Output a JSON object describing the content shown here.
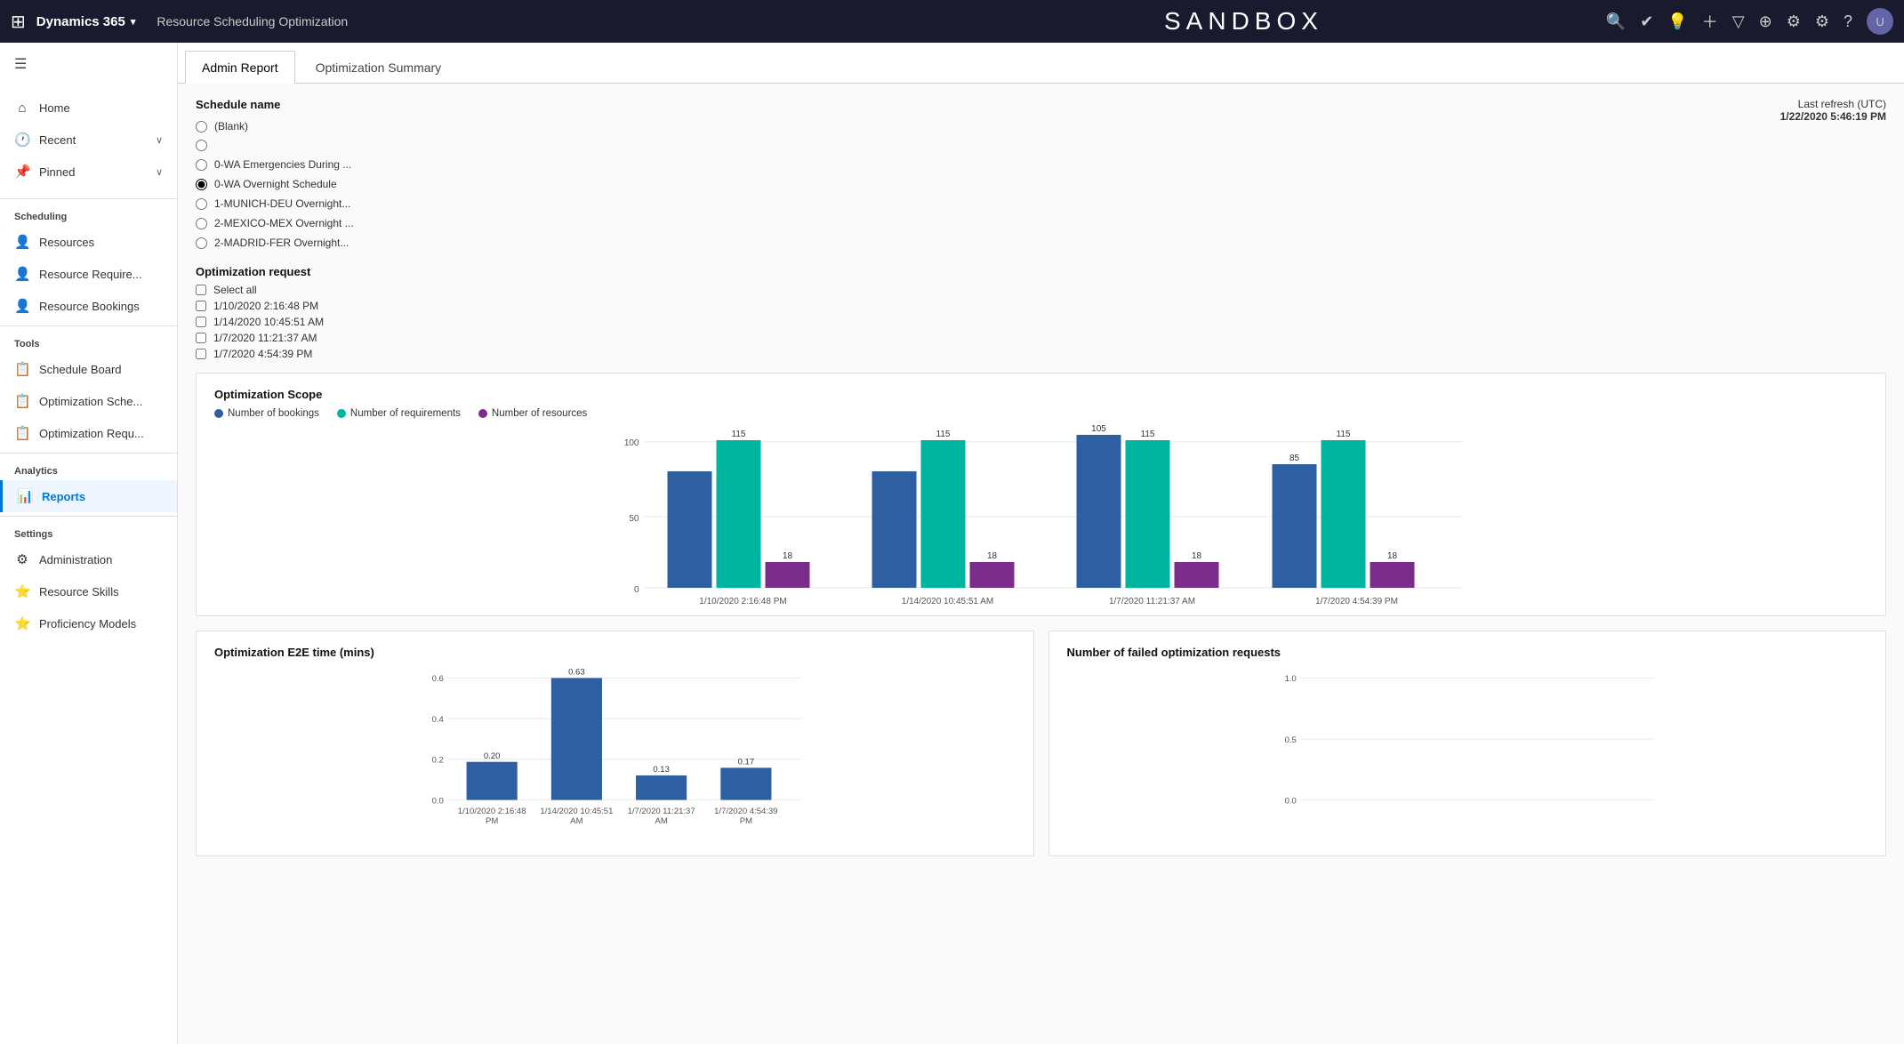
{
  "topbar": {
    "apps_icon": "⊞",
    "brand": "Dynamics 365",
    "brand_chevron": "▾",
    "title": "Resource Scheduling Optimization",
    "sandbox": "SANDBOX",
    "icons": [
      "🔍",
      "✓",
      "💡",
      "+",
      "▽",
      "⊕",
      "⚙",
      "⚙",
      "?"
    ],
    "avatar_label": "U"
  },
  "sidebar": {
    "hamburger": "☰",
    "items": [
      {
        "id": "home",
        "icon": "⌂",
        "label": "Home",
        "group": null
      },
      {
        "id": "recent",
        "icon": "🕐",
        "label": "Recent",
        "chevron": "∨",
        "group": null
      },
      {
        "id": "pinned",
        "icon": "📌",
        "label": "Pinned",
        "chevron": "∨",
        "group": null
      },
      {
        "id": "resources",
        "icon": "👤",
        "label": "Resources",
        "group": "Scheduling"
      },
      {
        "id": "resource-requirements",
        "icon": "👤",
        "label": "Resource Require...",
        "group": null
      },
      {
        "id": "resource-bookings",
        "icon": "👤",
        "label": "Resource Bookings",
        "group": null
      },
      {
        "id": "schedule-board",
        "icon": "📋",
        "label": "Schedule Board",
        "group": "Tools"
      },
      {
        "id": "optimization-schedule",
        "icon": "📋",
        "label": "Optimization Sche...",
        "group": null
      },
      {
        "id": "optimization-requests",
        "icon": "📋",
        "label": "Optimization Requ...",
        "group": null
      },
      {
        "id": "reports",
        "icon": "📊",
        "label": "Reports",
        "group": "Analytics",
        "active": true
      },
      {
        "id": "administration",
        "icon": "⚙",
        "label": "Administration",
        "group": "Settings"
      },
      {
        "id": "resource-skills",
        "icon": "⭐",
        "label": "Resource Skills",
        "group": null
      },
      {
        "id": "proficiency-models",
        "icon": "⭐",
        "label": "Proficiency Models",
        "group": null
      }
    ]
  },
  "tabs": [
    {
      "id": "admin-report",
      "label": "Admin Report",
      "active": true
    },
    {
      "id": "optimization-summary",
      "label": "Optimization Summary",
      "active": false
    }
  ],
  "filter": {
    "schedule_name_label": "Schedule name",
    "options": [
      {
        "id": "blank",
        "label": "(Blank)",
        "selected": false
      },
      {
        "id": "opt2",
        "label": "",
        "selected": false
      },
      {
        "id": "wa-emergencies",
        "label": "0-WA Emergencies During ...",
        "selected": false
      },
      {
        "id": "wa-overnight",
        "label": "0-WA Overnight Schedule",
        "selected": true
      },
      {
        "id": "munich",
        "label": "1-MUNICH-DEU Overnight...",
        "selected": false
      },
      {
        "id": "mexico",
        "label": "2-MEXICO-MEX Overnight ...",
        "selected": false
      },
      {
        "id": "madrid",
        "label": "2-MADRID-FER Overnight...",
        "selected": false
      }
    ],
    "optimization_request_label": "Optimization request",
    "checkboxes": [
      {
        "id": "select-all",
        "label": "Select all",
        "checked": false
      },
      {
        "id": "req1",
        "label": "1/10/2020 2:16:48 PM",
        "checked": false
      },
      {
        "id": "req2",
        "label": "1/14/2020 10:45:51 AM",
        "checked": false
      },
      {
        "id": "req3",
        "label": "1/7/2020 11:21:37 AM",
        "checked": false
      },
      {
        "id": "req4",
        "label": "1/7/2020 4:54:39 PM",
        "checked": false
      }
    ]
  },
  "last_refresh": {
    "label": "Last refresh (UTC)",
    "value": "1/22/2020 5:46:19 PM"
  },
  "scope_chart": {
    "title": "Optimization Scope",
    "legend": [
      {
        "label": "Number of bookings",
        "color": "#2e5fa3"
      },
      {
        "label": "Number of requirements",
        "color": "#00b5a0"
      },
      {
        "label": "Number of resources",
        "color": "#7b2d8b"
      }
    ],
    "y_labels": [
      "100",
      "50",
      "0"
    ],
    "groups": [
      {
        "label": "1/10/2020 2:16:48 PM",
        "bookings": 80,
        "bookings_val": "~80",
        "requirements": 115,
        "requirements_val": "115",
        "resources": 18,
        "resources_val": "18"
      },
      {
        "label": "1/14/2020 10:45:51 AM",
        "bookings": 82,
        "bookings_val": "~82",
        "requirements": 115,
        "requirements_val": "115",
        "resources": 18,
        "resources_val": "18"
      },
      {
        "label": "1/7/2020 11:21:37 AM",
        "bookings": 105,
        "bookings_val": "105",
        "requirements": 115,
        "requirements_val": "115",
        "resources": 18,
        "resources_val": "18"
      },
      {
        "label": "1/7/2020 4:54:39 PM",
        "bookings": 85,
        "bookings_val": "85",
        "requirements": 115,
        "requirements_val": "115",
        "resources": 18,
        "resources_val": "18"
      }
    ]
  },
  "e2e_chart": {
    "title": "Optimization E2E time (mins)",
    "y_labels": [
      "0.6",
      "0.4",
      "0.2",
      "0.0"
    ],
    "bars": [
      {
        "label": "1/10/2020 2:16:48\nPM",
        "label1": "1/10/2020 2:16:48",
        "label2": "PM",
        "value": 0.2,
        "height_pct": 32
      },
      {
        "label": "1/14/2020 10:45:51\nAM",
        "label1": "1/14/2020 10:45:51",
        "label2": "AM",
        "value": 0.63,
        "height_pct": 100
      },
      {
        "label": "1/7/2020 11:21:37\nAM",
        "label1": "1/7/2020 11:21:37",
        "label2": "AM",
        "value": 0.13,
        "height_pct": 21
      },
      {
        "label": "1/7/2020 4:54:39\nPM",
        "label1": "1/7/2020 4:54:39",
        "label2": "PM",
        "value": 0.17,
        "height_pct": 27
      }
    ]
  },
  "failed_chart": {
    "title": "Number of failed optimization requests",
    "y_labels": [
      "1.0",
      "0.5",
      "0.0"
    ]
  },
  "colors": {
    "booking": "#2e5fa3",
    "requirement": "#00b5a0",
    "resource": "#7b2d8b",
    "e2e_bar": "#2e5fa3",
    "active_tab_border": "#0078d4",
    "sidebar_active": "#0078d4"
  }
}
